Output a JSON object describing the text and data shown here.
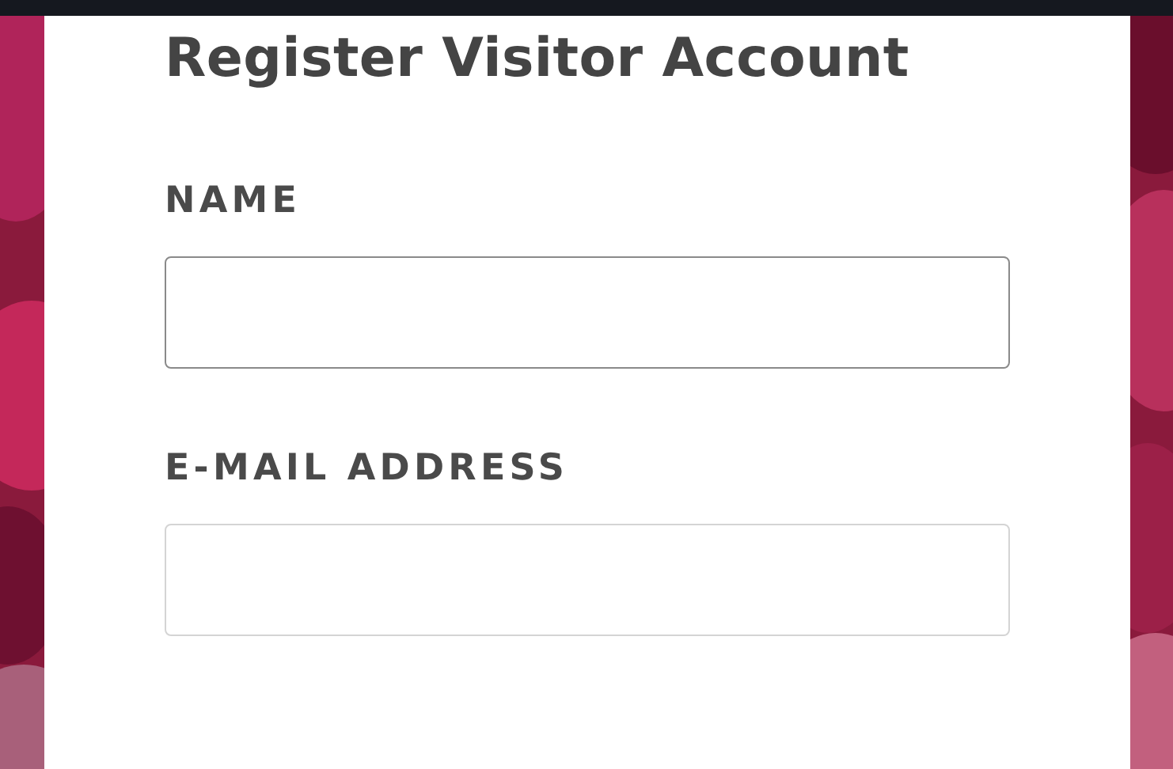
{
  "title": "Register Visitor Account",
  "fields": [
    {
      "label": "NAME",
      "focused": true
    },
    {
      "label": "E-MAIL ADDRESS",
      "focused": false
    }
  ]
}
